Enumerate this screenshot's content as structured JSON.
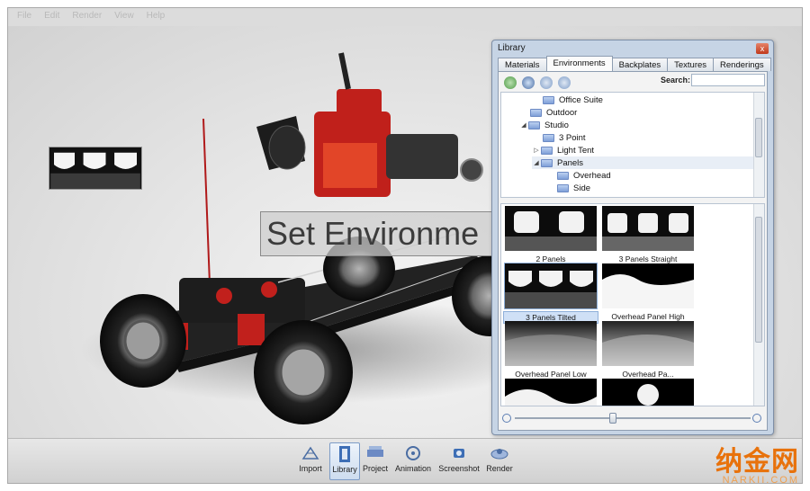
{
  "menu": [
    "File",
    "Edit",
    "Render",
    "View",
    "Help"
  ],
  "viewport": {
    "overlay_text": "Set Environme"
  },
  "toolbar": [
    {
      "label": "Import",
      "icon": "import-icon"
    },
    {
      "label": "Library",
      "icon": "library-icon",
      "active": true
    },
    {
      "label": "Project",
      "icon": "project-icon"
    },
    {
      "label": "Animation",
      "icon": "animation-icon"
    },
    {
      "label": "Screenshot",
      "icon": "screenshot-icon"
    },
    {
      "label": "Render",
      "icon": "render-icon"
    }
  ],
  "library": {
    "title": "Library",
    "close": "x",
    "tabs": [
      "Materials",
      "Environments",
      "Backplates",
      "Textures",
      "Renderings"
    ],
    "active_tab": "Environments",
    "search_label": "Search:",
    "search_value": "",
    "tree": [
      {
        "label": "Office Suite",
        "level": 2
      },
      {
        "label": "Outdoor",
        "level": 1
      },
      {
        "label": "Studio",
        "level": 1,
        "expanded": true
      },
      {
        "label": "3 Point",
        "level": 2
      },
      {
        "label": "Light Tent",
        "level": 2,
        "collapsed": true
      },
      {
        "label": "Panels",
        "level": 2,
        "expanded": true,
        "selected": true
      },
      {
        "label": "Overhead",
        "level": 3
      },
      {
        "label": "Side",
        "level": 3
      }
    ],
    "thumbnails": [
      {
        "label": "2 Panels",
        "kind": "panels2"
      },
      {
        "label": "3 Panels Straight",
        "kind": "panels3"
      },
      {
        "label": "3 Panels Tilted",
        "kind": "panels3t",
        "selected": true
      },
      {
        "label": "Overhead Panel High",
        "kind": "overhigh"
      },
      {
        "label": "Overhead Panel Low",
        "kind": "overlow"
      },
      {
        "label": "Overhead Pa...",
        "kind": "overmed"
      }
    ]
  },
  "watermark": {
    "main": "纳金网",
    "sub": "NARKII.COM"
  },
  "colors": {
    "panel_frame": "#c6d4e5",
    "accent_red": "#d8251a",
    "selection": "#cfe0f6",
    "watermark": "#e8720c"
  }
}
